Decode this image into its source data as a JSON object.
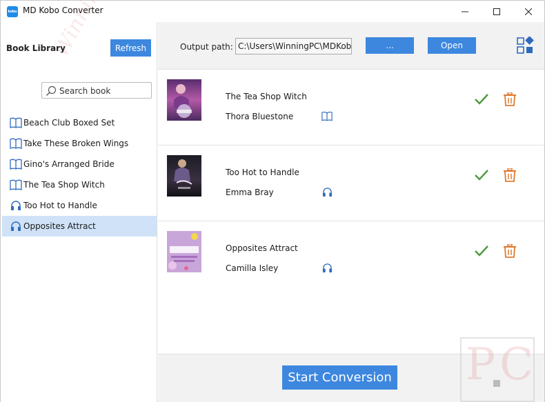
{
  "window": {
    "title": "MD Kobo Converter",
    "icon_text": "kobo",
    "accent_color": "#3d87df"
  },
  "sidebar": {
    "title": "Book Library",
    "refresh_label": "Refresh",
    "search_placeholder": "Search book",
    "books": [
      {
        "label": "Beach Club Boxed Set",
        "type": "book-icon",
        "selected": false
      },
      {
        "label": "Take These Broken Wings",
        "type": "book-icon",
        "selected": false
      },
      {
        "label": "Gino's Arranged Bride",
        "type": "book-icon",
        "selected": false
      },
      {
        "label": "The Tea Shop Witch",
        "type": "book-icon",
        "selected": false
      },
      {
        "label": "Too Hot to Handle",
        "type": "headphones-icon",
        "selected": false
      },
      {
        "label": "Opposites Attract",
        "type": "headphones-icon",
        "selected": true
      }
    ]
  },
  "toolbar": {
    "output_label": "Output path:",
    "output_value": "C:\\Users\\WinningPC\\MDKobo",
    "browse_label": "...",
    "open_label": "Open"
  },
  "rows": [
    {
      "title": "The Tea Shop Witch",
      "author": "Thora Bluestone",
      "type": "book-icon"
    },
    {
      "title": "Too Hot to Handle",
      "author": "Emma Bray",
      "type": "headphones-icon"
    },
    {
      "title": "Opposites Attract",
      "author": "Camilla Isley",
      "type": "headphones-icon"
    }
  ],
  "footer": {
    "start_label": "Start Conversion"
  }
}
